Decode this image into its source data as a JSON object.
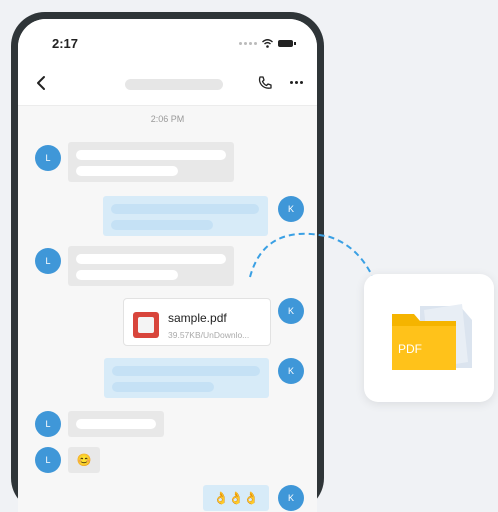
{
  "status_bar": {
    "time": "2:17"
  },
  "chat": {
    "timestamp": "2:06 PM",
    "contact_initial": "L",
    "my_initial": "K",
    "file": {
      "name": "sample.pdf",
      "meta": "39.57KB/UnDownlo..."
    },
    "emoji_reply": "😊",
    "emoji_thumbs": "👌👌👌"
  },
  "doc_card": {
    "folder_label": "PDF"
  },
  "colors": {
    "accent": "#3f97d8",
    "folder": "#f5b400",
    "arrow": "#3aa0e4"
  }
}
